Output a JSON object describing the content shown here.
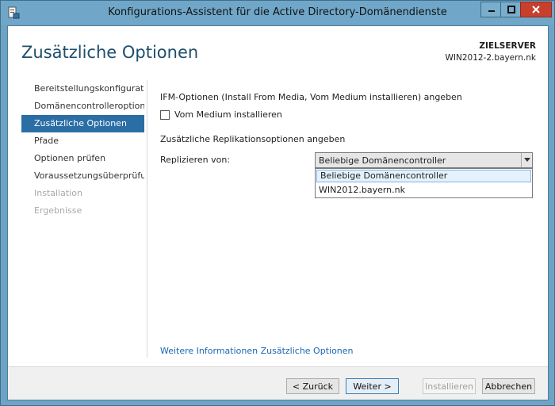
{
  "window": {
    "title": "Konfigurations-Assistent für die Active Directory-Domänendienste",
    "close_color": "#c7402e"
  },
  "header": {
    "page_title": "Zusätzliche Optionen",
    "server_label": "ZIELSERVER",
    "server_name": "WIN2012-2.bayern.nk"
  },
  "nav": {
    "items": [
      {
        "label": "Bereitstellungskonfigurati...",
        "state": "normal"
      },
      {
        "label": "Domänencontrolleroption...",
        "state": "normal"
      },
      {
        "label": "Zusätzliche Optionen",
        "state": "active"
      },
      {
        "label": "Pfade",
        "state": "normal"
      },
      {
        "label": "Optionen prüfen",
        "state": "normal"
      },
      {
        "label": "Voraussetzungsüberprüfu...",
        "state": "normal"
      },
      {
        "label": "Installation",
        "state": "disabled"
      },
      {
        "label": "Ergebnisse",
        "state": "disabled"
      }
    ]
  },
  "content": {
    "ifm_heading": "IFM-Optionen (Install From Media, Vom Medium installieren) angeben",
    "ifm_checkbox_label": "Vom Medium installieren",
    "repl_heading": "Zusätzliche Replikationsoptionen angeben",
    "repl_label": "Replizieren von:",
    "repl_selected": "Beliebige Domänencontroller",
    "repl_options": [
      "Beliebige Domänencontroller",
      "WIN2012.bayern.nk"
    ]
  },
  "more_info_link": "Weitere Informationen Zusätzliche Optionen",
  "footer": {
    "back_label": "< Zurück",
    "next_label": "Weiter >",
    "install_label": "Installieren",
    "cancel_label": "Abbrechen"
  }
}
